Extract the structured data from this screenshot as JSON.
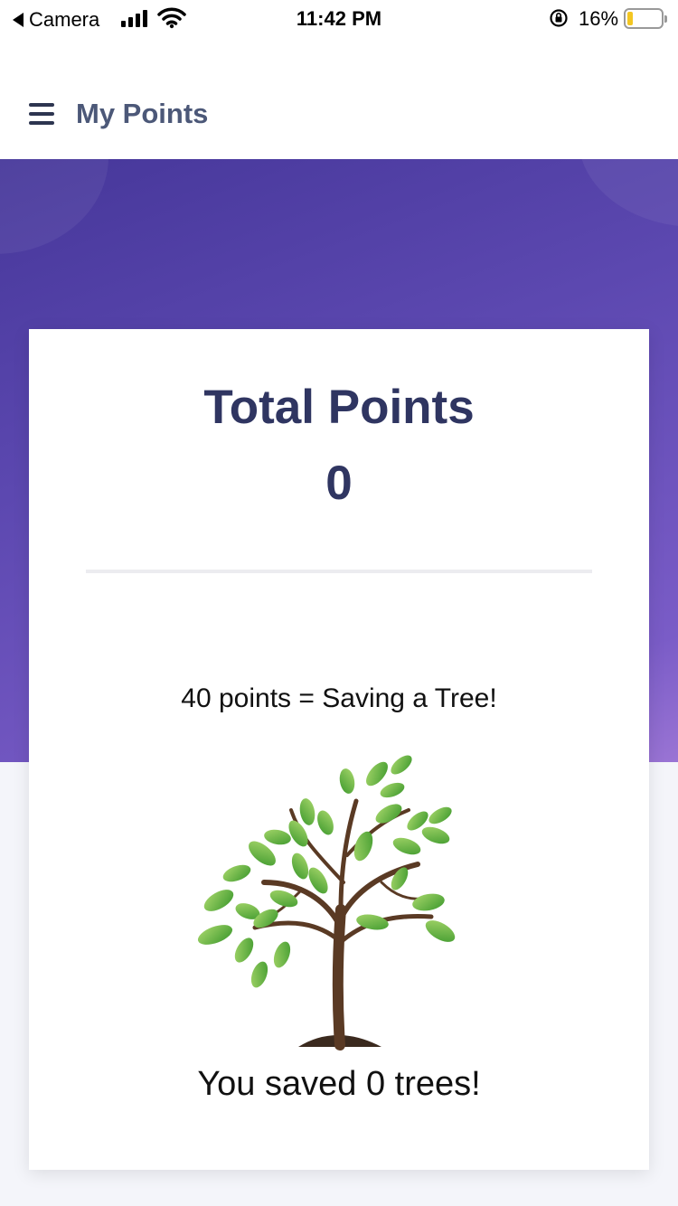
{
  "status_bar": {
    "back_app": "Camera",
    "time": "11:42 PM",
    "battery_percent": "16%",
    "battery_level": 0.16
  },
  "header": {
    "title": "My Points",
    "menu_icon": "hamburger-menu-icon"
  },
  "colors": {
    "hero_gradient_start": "#46379a",
    "hero_gradient_end": "#9a74d4",
    "title_text": "#2f3561",
    "header_text": "#4c5878"
  },
  "points_card": {
    "title": "Total Points",
    "value": "0",
    "tree_note": "40 points = Saving a Tree!",
    "tree_icon": "tree-illustration",
    "saved_text": "You saved 0 trees!"
  }
}
